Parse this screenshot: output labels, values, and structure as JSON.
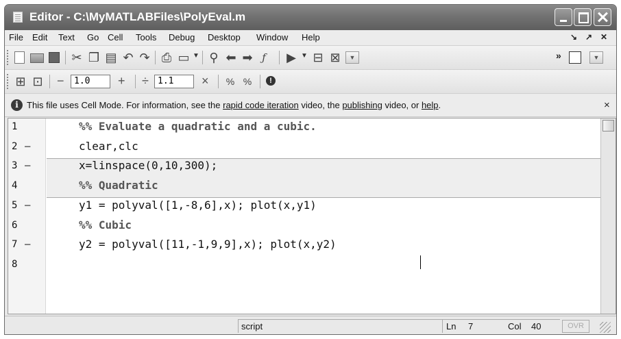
{
  "window": {
    "title": "Editor - C:\\MyMATLABFiles\\PolyEval.m"
  },
  "menu": [
    "File",
    "Edit",
    "Text",
    "Go",
    "Cell",
    "Tools",
    "Debug",
    "Desktop",
    "Window",
    "Help"
  ],
  "menu_right": {
    "undock": "↘",
    "arrow": "↗",
    "close": "✕"
  },
  "toolbar1": {
    "icons": [
      "new-file-icon",
      "open-folder-icon",
      "save-icon",
      "cut-icon",
      "copy-icon",
      "paste-icon",
      "undo-icon",
      "redo-icon",
      "print-icon",
      "find-files-icon",
      "find-icon",
      "back-icon",
      "forward-icon",
      "function-icon",
      "run-icon",
      "step-icon",
      "breakpoint-icon"
    ],
    "overflow": "»"
  },
  "toolbar2": {
    "decrement_label": "−",
    "value1": "1.0",
    "increment_label": "+",
    "divide_label": "÷",
    "value2": "1.1",
    "multiply_label": "×",
    "icon_names": [
      "insert-cell-icon",
      "show-cell-icon",
      "percent-plus-icon",
      "percent-minus-icon",
      "info-icon"
    ]
  },
  "infobar": {
    "prefix": "This file uses Cell Mode. For information, see the ",
    "link1": "rapid code iteration",
    "mid1": " video, the ",
    "link2": "publishing",
    "mid2": " video, or ",
    "link3": "help",
    "suffix": ".",
    "close": "×"
  },
  "editor": {
    "lines": [
      {
        "num": "1",
        "dash": "",
        "text": "%% Evaluate a quadratic and a cubic.",
        "comment": true
      },
      {
        "num": "2",
        "dash": "–",
        "text": "clear,clc",
        "comment": false
      },
      {
        "num": "3",
        "dash": "–",
        "text": "x=linspace(0,10,300);",
        "comment": false
      },
      {
        "num": "4",
        "dash": "",
        "text": "%% Quadratic",
        "comment": true
      },
      {
        "num": "5",
        "dash": "–",
        "text": "y1 = polyval([1,-8,6],x); plot(x,y1)",
        "comment": false
      },
      {
        "num": "6",
        "dash": "",
        "text": "%% Cubic",
        "comment": true
      },
      {
        "num": "7",
        "dash": "–",
        "text": "y2 = polyval([11,-1,9,9],x); plot(x,y2)",
        "comment": false
      },
      {
        "num": "8",
        "dash": "",
        "text": "",
        "comment": false
      }
    ]
  },
  "statusbar": {
    "mode": "script",
    "ln_label": "Ln",
    "ln_value": "7",
    "col_label": "Col",
    "col_value": "40",
    "ovr": "OVR"
  }
}
